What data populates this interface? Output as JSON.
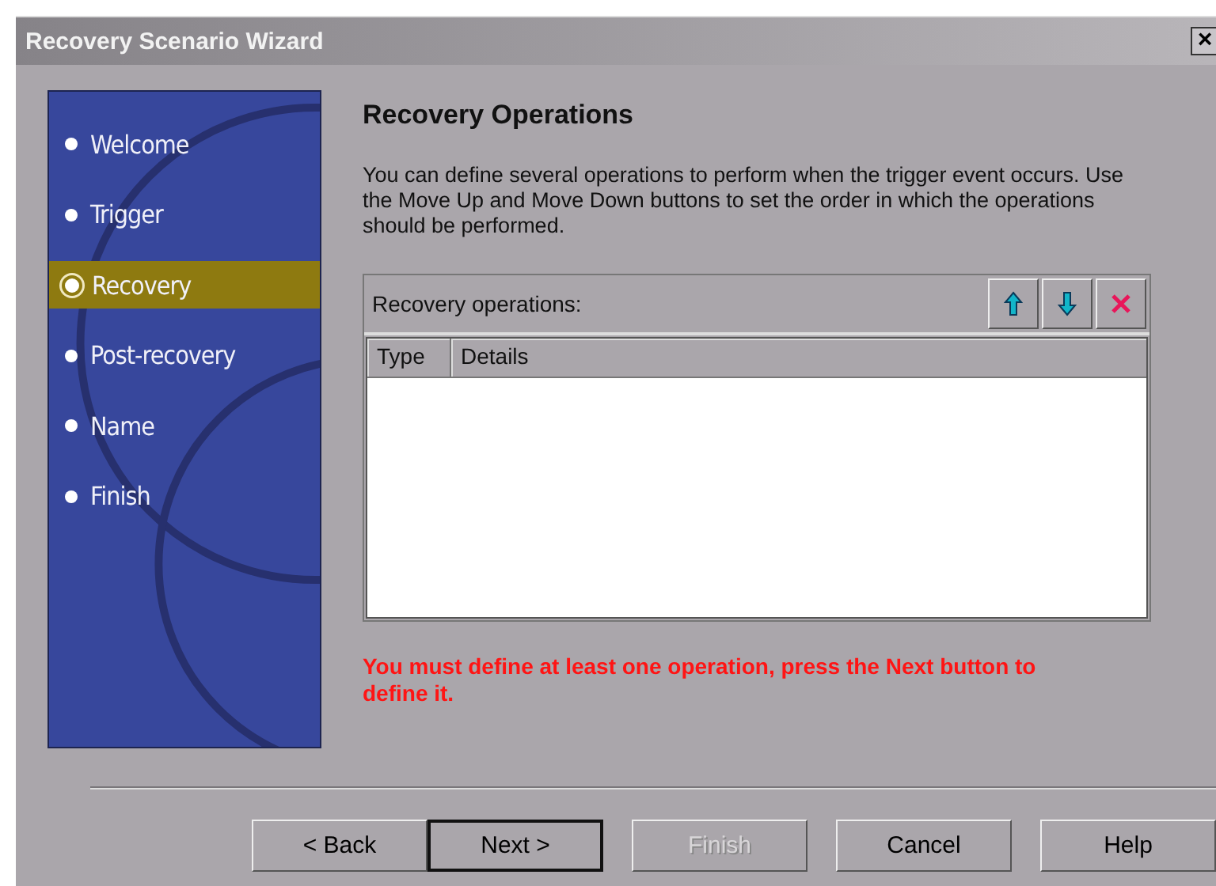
{
  "window": {
    "title": "Recovery Scenario Wizard",
    "close": "×"
  },
  "steps": [
    {
      "label": "Welcome",
      "selected": false
    },
    {
      "label": "Trigger",
      "selected": false
    },
    {
      "label": "Recovery",
      "selected": true
    },
    {
      "label": "Post-recovery",
      "selected": false
    },
    {
      "label": "Name",
      "selected": false
    },
    {
      "label": "Finish",
      "selected": false
    }
  ],
  "heading": "Recovery Operations",
  "description": "You can define several operations to perform when the trigger event occurs. Use the Move Up and Move Down buttons to set the order in which the operations should be performed.",
  "operations": {
    "label": "Recovery operations:",
    "tools": [
      {
        "kind": "up"
      },
      {
        "kind": "down"
      },
      {
        "kind": "delete"
      }
    ],
    "columns": [
      "Type",
      "Details"
    ]
  },
  "error": "You must define at least one operation, press the Next button to define it.",
  "buttons": [
    {
      "label": "< Back",
      "disabled": false,
      "default": false
    },
    {
      "label": "Next >",
      "disabled": false,
      "default": true
    },
    {
      "label": "Finish",
      "disabled": true,
      "default": false
    },
    {
      "label": "Cancel",
      "disabled": false,
      "default": false
    },
    {
      "label": "Help",
      "disabled": false,
      "default": false
    }
  ]
}
